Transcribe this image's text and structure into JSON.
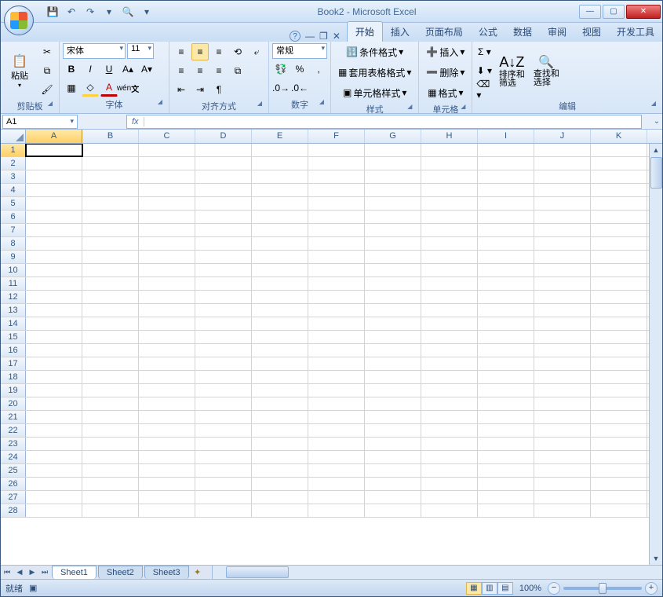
{
  "title": "Book2 - Microsoft Excel",
  "qat": {
    "save": "💾",
    "undo": "↶",
    "redo": "↷",
    "print": "🔍"
  },
  "tabs": [
    "开始",
    "插入",
    "页面布局",
    "公式",
    "数据",
    "审阅",
    "视图",
    "开发工具"
  ],
  "activeTab": 0,
  "ribbon": {
    "clipboard": {
      "label": "剪贴板",
      "paste": "粘贴"
    },
    "font": {
      "label": "字体",
      "name": "宋体",
      "size": "11"
    },
    "align": {
      "label": "对齐方式"
    },
    "number": {
      "label": "数字",
      "format": "常规"
    },
    "styles": {
      "label": "样式",
      "cond": "条件格式",
      "table": "套用表格格式",
      "cell": "单元格样式"
    },
    "cells": {
      "label": "单元格",
      "insert": "插入",
      "delete": "删除",
      "format": "格式"
    },
    "editing": {
      "label": "编辑",
      "sort": "排序和\n筛选",
      "find": "查找和\n选择"
    }
  },
  "namebox": "A1",
  "fx": "fx",
  "columns": [
    "A",
    "B",
    "C",
    "D",
    "E",
    "F",
    "G",
    "H",
    "I",
    "J",
    "K"
  ],
  "rowcount": 28,
  "activeCell": {
    "row": 1,
    "col": "A"
  },
  "sheets": [
    "Sheet1",
    "Sheet2",
    "Sheet3"
  ],
  "activeSheet": 0,
  "status": {
    "ready": "就绪",
    "zoom": "100%"
  }
}
